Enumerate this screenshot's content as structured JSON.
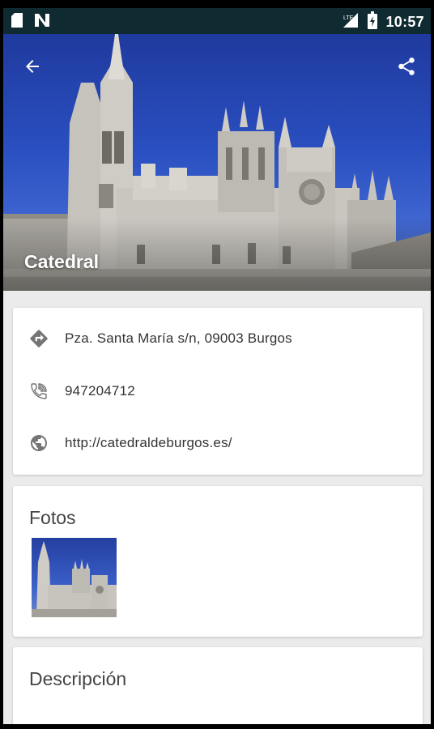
{
  "status_bar": {
    "time": "10:57",
    "icons": [
      "sd-card-icon",
      "n-notification-icon",
      "signal-icon",
      "battery-icon"
    ]
  },
  "place": {
    "title": "Catedral"
  },
  "toolbar": {
    "back_icon": "arrow-back-icon",
    "share_icon": "share-icon"
  },
  "info": {
    "address": "Pza. Santa María s/n, 09003 Burgos",
    "phone": "947204712",
    "website": "http://catedraldeburgos.es/"
  },
  "photos": {
    "title": "Fotos"
  },
  "description": {
    "title": "Descripción"
  },
  "colors": {
    "status_bar": "#0f2a30",
    "sky": "#2a4fc0",
    "background": "#ebebeb",
    "card": "#ffffff",
    "icon_gray": "#757575"
  }
}
